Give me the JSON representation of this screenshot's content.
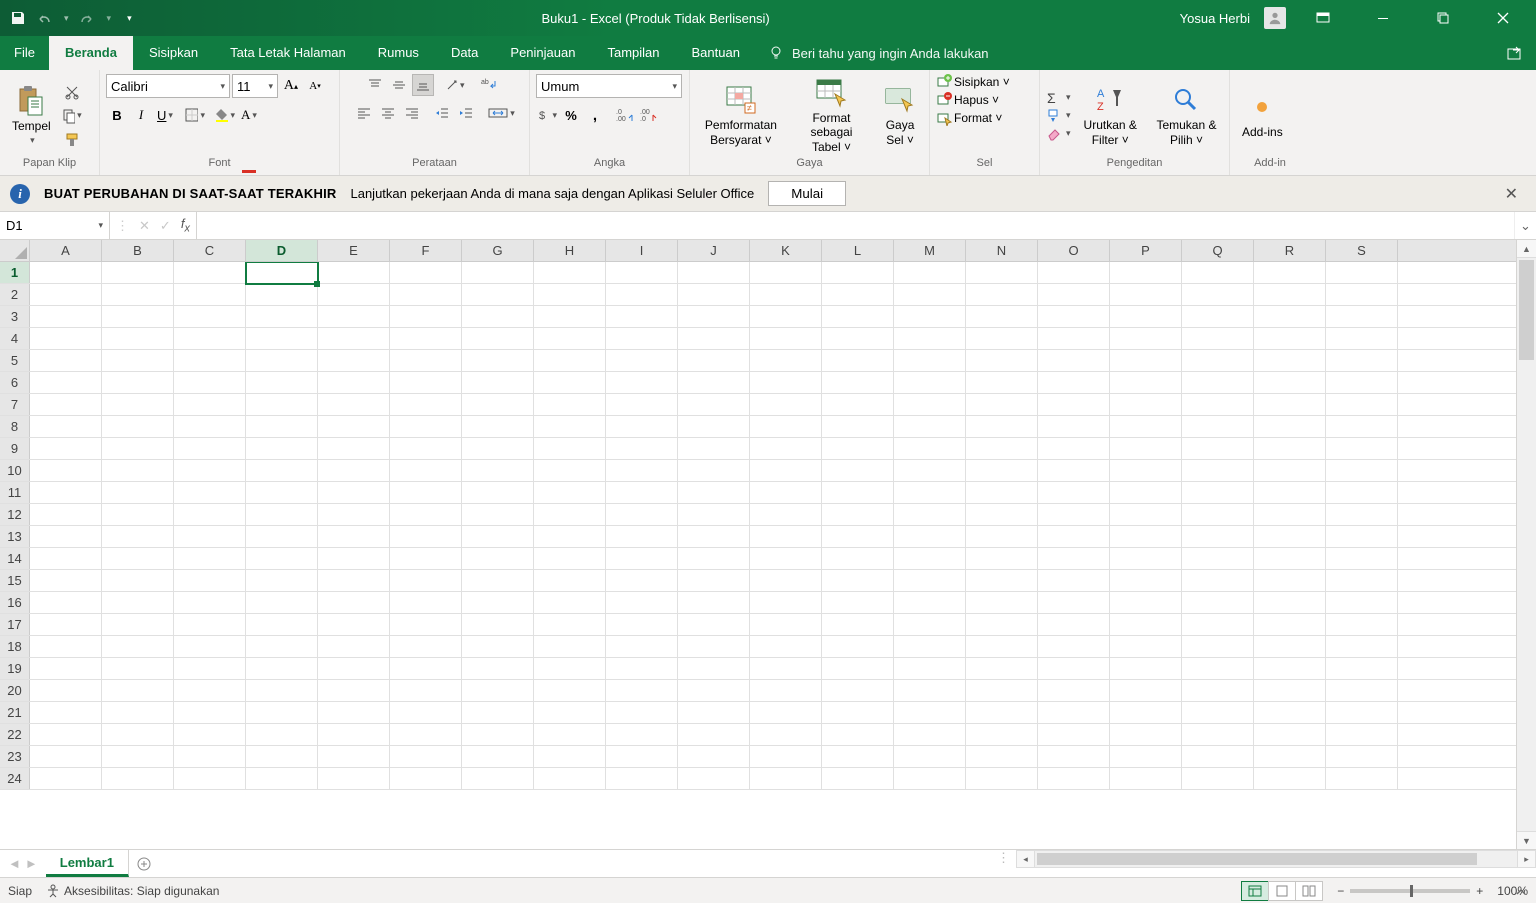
{
  "title": "Buku1  -  Excel (Produk Tidak Berlisensi)",
  "user_name": "Yosua Herbi",
  "tabs": [
    "File",
    "Beranda",
    "Sisipkan",
    "Tata Letak Halaman",
    "Rumus",
    "Data",
    "Peninjauan",
    "Tampilan",
    "Bantuan"
  ],
  "active_tab_index": 1,
  "tellme_placeholder": "Beri tahu yang ingin Anda lakukan",
  "ribbon": {
    "clipboard": {
      "paste": "Tempel",
      "group": "Papan Klip"
    },
    "font": {
      "name": "Calibri",
      "size": "11",
      "group": "Font"
    },
    "alignment": {
      "group": "Perataan"
    },
    "number": {
      "format": "Umum",
      "group": "Angka"
    },
    "styles": {
      "cond": "Pemformatan Bersyarat ˅",
      "table": "Format sebagai Tabel ˅",
      "cell": "Gaya Sel ˅",
      "group": "Gaya"
    },
    "cells": {
      "insert": "Sisipkan ˅",
      "delete": "Hapus ˅",
      "format": "Format ˅",
      "group": "Sel"
    },
    "editing": {
      "sort": "Urutkan & Filter ˅",
      "find": "Temukan & Pilih ˅",
      "group": "Pengeditan"
    },
    "addins": {
      "label": "Add-ins",
      "group": "Add-in"
    }
  },
  "messagebar": {
    "bold": "BUAT PERUBAHAN DI SAAT-SAAT TERAKHIR",
    "text": "Lanjutkan pekerjaan Anda di mana saja dengan Aplikasi Seluler Office",
    "button": "Mulai"
  },
  "namebox": "D1",
  "formula": "",
  "columns": [
    "A",
    "B",
    "C",
    "D",
    "E",
    "F",
    "G",
    "H",
    "I",
    "J",
    "K",
    "L",
    "M",
    "N",
    "O",
    "P",
    "Q",
    "R",
    "S"
  ],
  "row_count": 24,
  "active_cell": {
    "col_index": 3,
    "row_index": 0
  },
  "sheet_tab": "Lembar1",
  "status": {
    "ready": "Siap",
    "accessibility": "Aksesibilitas: Siap digunakan",
    "zoom": "100%"
  }
}
